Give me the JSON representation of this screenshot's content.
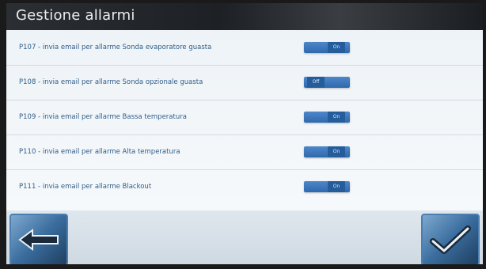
{
  "title": "Gestione allarmi",
  "alarms": [
    {
      "label": "P107 - invia email per allarme Sonda evaporatore guasta",
      "state": "On"
    },
    {
      "label": "P108 - invia email per allarme Sonda opzionale guasta",
      "state": "Off"
    },
    {
      "label": "P109 - invia email per allarme Bassa temperatura",
      "state": "On"
    },
    {
      "label": "P110 - invia email per allarme Alta temperatura",
      "state": "On"
    },
    {
      "label": "P111 - invia email per allarme Blackout",
      "state": "On"
    }
  ],
  "icons": {
    "back": "arrow-left-icon",
    "confirm": "checkmark-icon"
  },
  "colors": {
    "toggle": "#2f69ad",
    "label": "#2f5d8a",
    "titlebar": "#1d2024"
  }
}
